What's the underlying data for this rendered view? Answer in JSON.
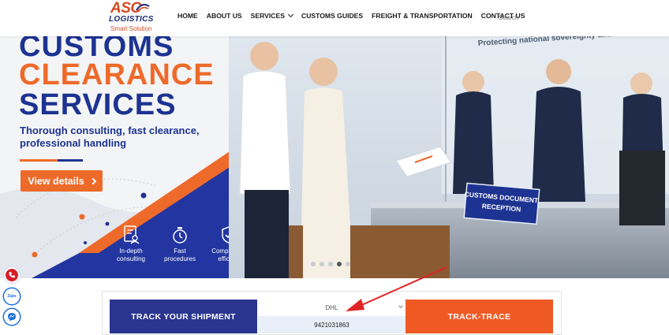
{
  "header": {
    "logo": {
      "brand": "ASC",
      "name": "LOGISTICS",
      "tagline": "Smart Solution"
    },
    "nav": [
      {
        "label": "HOME"
      },
      {
        "label": "ABOUT US"
      },
      {
        "label": "SERVICES",
        "has_dropdown": true
      },
      {
        "label": "CUSTOMS GUIDES"
      },
      {
        "label": "FREIGHT & TRANSPORTATION"
      },
      {
        "label": "CONTACT US"
      }
    ],
    "search_placeholder": "Search"
  },
  "hero": {
    "title_line1": "CUSTOMS",
    "title_line2": "CLEARANCE",
    "title_line3": "SERVICES",
    "subtitle": "Thorough consulting, fast clearance, professional handling",
    "cta_label": "View details",
    "features": [
      {
        "icon": "document-user-icon",
        "label": "In-depth consulting"
      },
      {
        "icon": "stopwatch-icon",
        "label": "Fast procedures"
      },
      {
        "icon": "shield-check-icon",
        "label": "Compliant & efficient"
      }
    ],
    "banner_text": "Protecting national sovereignty and interests",
    "counter_sign": "CUSTOMS DOCUMENT RECEPTION",
    "slider": {
      "count": 5,
      "active_index": 3
    }
  },
  "side_contacts": [
    {
      "icon": "phone-icon"
    },
    {
      "icon": "zalo-icon",
      "label": "Zalo"
    },
    {
      "icon": "messenger-icon"
    }
  ],
  "tracking": {
    "label": "TRACK YOUR SHIPMENT",
    "carrier": "DHL",
    "tracking_number": "9421031863",
    "button_label": "TRACK-TRACE"
  },
  "colors": {
    "navy": "#1d3391",
    "orange": "#ee6a2a",
    "track_label_bg": "#2a3590",
    "track_button_bg": "#ef5a24",
    "annotation_arrow": "#e02424"
  }
}
